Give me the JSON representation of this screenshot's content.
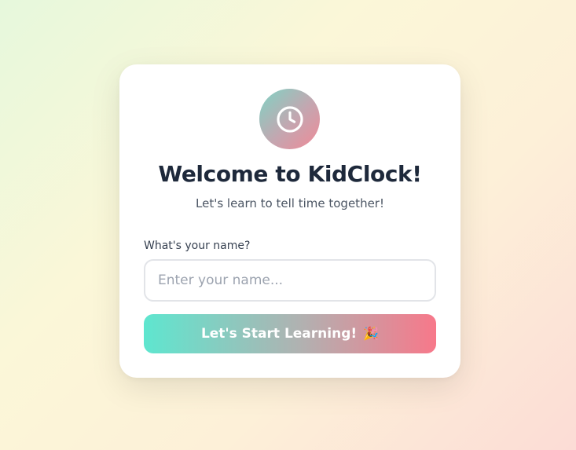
{
  "welcome": {
    "title": "Welcome to KidClock!",
    "subtitle": "Let's learn to tell time together!",
    "name_label": "What's your name?",
    "name_input": {
      "value": "",
      "placeholder": "Enter your name..."
    },
    "start_button": {
      "label": "Let's Start Learning!",
      "icon": "🎉"
    },
    "logo_icon": "clock-icon"
  },
  "colors": {
    "title": "#1e293b",
    "accent_teal": "#5ee6cf",
    "accent_pink": "#f7788a"
  }
}
